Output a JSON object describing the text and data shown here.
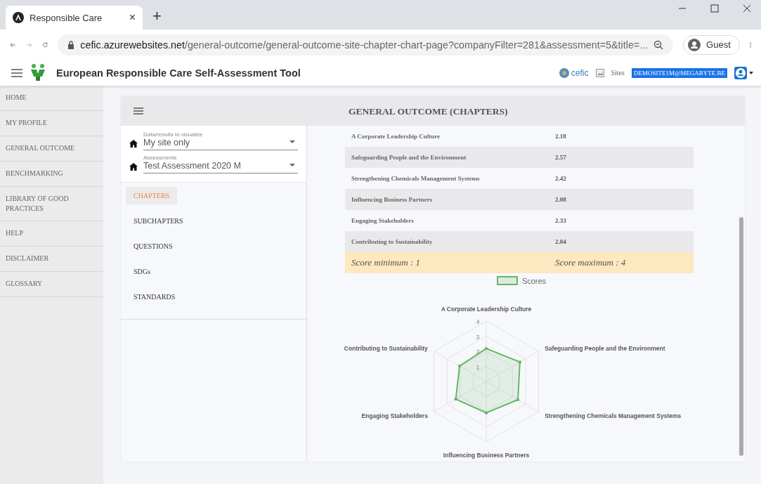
{
  "browser": {
    "tab_title": "Responsible Care",
    "tab_close": "×",
    "new_tab": "+",
    "url_host": "cefic.azurewebsites.net",
    "url_path": "/general-outcome/general-outcome-site-chapter-chart-page?companyFilter=281&assessment=5&title=...",
    "profile": "Guest"
  },
  "header": {
    "title": "European Responsible Care Self-Assessment Tool",
    "partner": "cefic",
    "sites": "Sites",
    "user": "DEMOSITE1M@MEGABYTE.BE"
  },
  "sidebar": {
    "items": [
      "HOME",
      "MY PROFILE",
      "GENERAL OUTCOME",
      "BENCHMARKING",
      "LIBRARY OF GOOD PRACTICES",
      "HELP",
      "DISCLAIMER",
      "GLOSSARY"
    ]
  },
  "filters": [
    {
      "label": "Data/results to visualize",
      "value": "My site only"
    },
    {
      "label": "Assessments",
      "value": "Test Assessment 2020 M"
    }
  ],
  "nav": [
    {
      "label": "CHAPTERS",
      "selected": true
    },
    {
      "label": "SUBCHAPTERS",
      "selected": false
    },
    {
      "label": "QUESTIONS",
      "selected": false
    },
    {
      "label": "SDGs",
      "selected": false
    },
    {
      "label": "STANDARDS",
      "selected": false
    }
  ],
  "panel": {
    "title": "GENERAL OUTCOME (CHAPTERS)",
    "rows": [
      {
        "chapter": "A Corporate Leadership Culture",
        "score": "2.18"
      },
      {
        "chapter": "Safeguarding People and the Environment",
        "score": "2.57"
      },
      {
        "chapter": "Strengthening Chemicals Management Systems",
        "score": "2.42"
      },
      {
        "chapter": "Influencing Business Partners",
        "score": "2.08"
      },
      {
        "chapter": "Engaging Stakeholders",
        "score": "2.33"
      },
      {
        "chapter": "Contributing to Sustainability",
        "score": "2.04"
      }
    ],
    "score_min": "Score minimum : 1",
    "score_max": "Score maximum : 4",
    "chart_data": {
      "type": "radar",
      "categories": [
        "A Corporate Leadership Culture",
        "Safeguarding People and the Environment",
        "Strengthening Chemicals Management Systems",
        "Influencing Business Partners",
        "Engaging Stakeholders",
        "Contributing to Sustainability"
      ],
      "series": [
        {
          "name": "Scores",
          "color": "#6ab56a",
          "values": [
            2.18,
            2.57,
            2.42,
            2.08,
            2.33,
            2.04
          ]
        }
      ],
      "ylim": [
        0,
        4
      ],
      "yticks": [
        1,
        2,
        3,
        4
      ]
    }
  }
}
